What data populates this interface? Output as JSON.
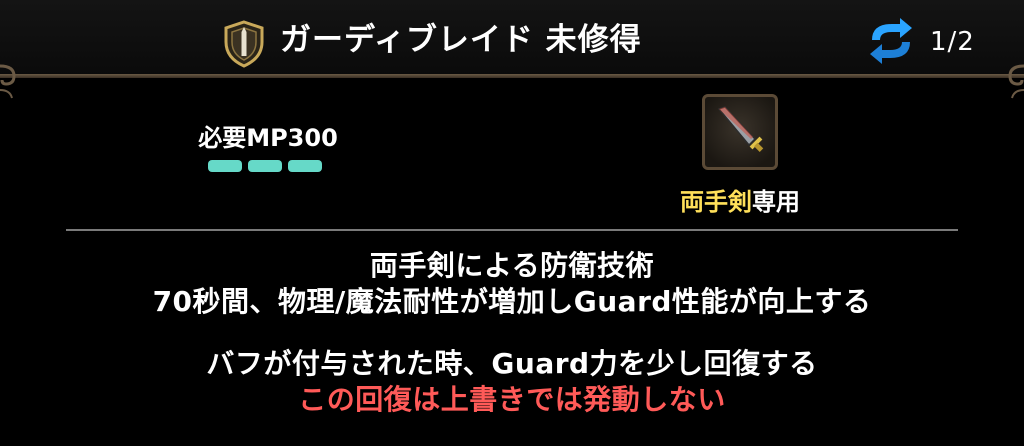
{
  "header": {
    "title": "ガーディブレイド 未修得",
    "page_indicator": "1/2",
    "icon": "shield-icon",
    "cycle_icon": "cycle-arrows-icon"
  },
  "skill": {
    "mp_requirement": "必要MP300",
    "mp_bars_count": 3,
    "weapon_icon": "sword-icon",
    "weapon_name": "両手剣",
    "weapon_suffix": "専用"
  },
  "description": {
    "line1": "両手剣による防衛技術",
    "line2": "70秒間、物理/魔法耐性が増加しGuard性能が向上する",
    "line3": "バフが付与された時、Guard力を少し回復する",
    "line4_warning": "この回復は上書きでは発動しない"
  },
  "colors": {
    "mp_bar": "#66d9c8",
    "weapon_name": "#ffe05a",
    "warning": "#ff5a58"
  }
}
